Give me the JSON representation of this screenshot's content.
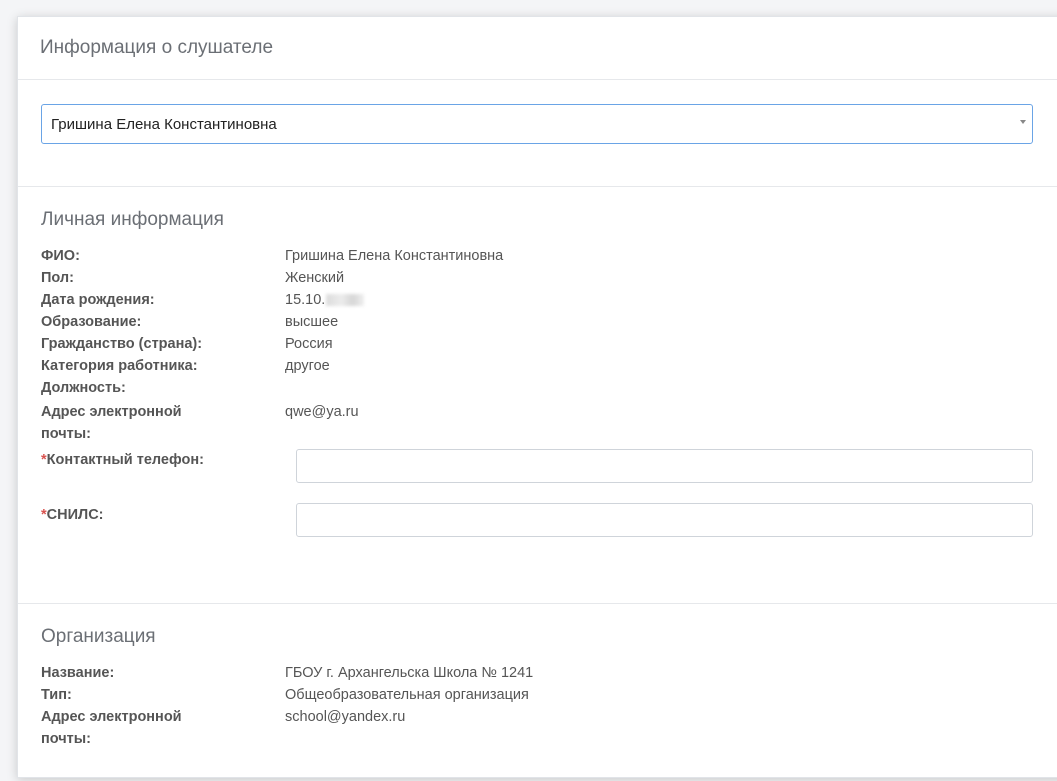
{
  "card": {
    "title": "Информация о слушателе"
  },
  "selector": {
    "selected": "Гришина Елена Константиновна"
  },
  "personal": {
    "title": "Личная информация",
    "rows": [
      {
        "label": "ФИО:",
        "value": "Гришина Елена Константиновна"
      },
      {
        "label": "Пол:",
        "value": "Женский"
      },
      {
        "label": "Дата рождения:",
        "value": "15.10."
      },
      {
        "label": "Образование:",
        "value": "высшее"
      },
      {
        "label": "Гражданство (страна):",
        "value": "Россия"
      },
      {
        "label": "Категория работника:",
        "value": "другое"
      },
      {
        "label": "Должность:",
        "value": ""
      },
      {
        "label": "Адрес электронной почты:",
        "value": "qwe@ya.ru"
      }
    ],
    "phone": {
      "required_mark": "*",
      "label": "Контактный телефон:",
      "value": ""
    },
    "snils": {
      "required_mark": "*",
      "label": "СНИЛС:",
      "value": ""
    }
  },
  "organization": {
    "title": "Организация",
    "rows": [
      {
        "label": "Название:",
        "value": "ГБОУ г. Архангельска Школа № 1241"
      },
      {
        "label": "Тип:",
        "value": "Общеобразовательная организация"
      },
      {
        "label": "Адрес электронной почты:",
        "value": "school@yandex.ru"
      }
    ]
  }
}
